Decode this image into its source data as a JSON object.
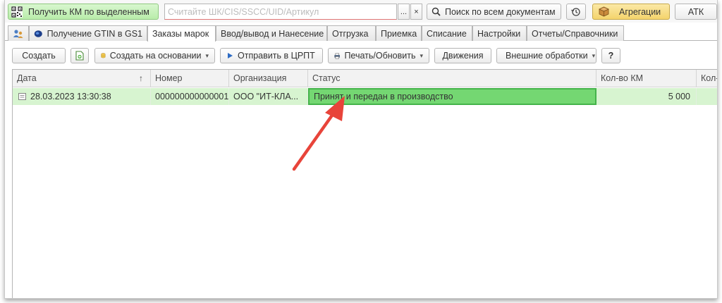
{
  "toolbar": {
    "scan_button": "Получить КМ по выделенным",
    "search_placeholder": "Считайте ШК/CIS/SSCC/UID/Артикул",
    "more_glyph": "...",
    "clear_glyph": "×",
    "search_all": "Поиск по всем документам",
    "aggregations": "Агрегации",
    "atk": "АТК"
  },
  "tabs": [
    {
      "label": ""
    },
    {
      "label": "Получение GTIN в GS1"
    },
    {
      "label": "Заказы марок"
    },
    {
      "label": "Ввод/вывод и Нанесение"
    },
    {
      "label": "Отгрузка"
    },
    {
      "label": "Приемка"
    },
    {
      "label": "Списание"
    },
    {
      "label": "Настройки"
    },
    {
      "label": "Отчеты/Справочники"
    }
  ],
  "commands": {
    "create": "Создать",
    "create_based": "Создать на основании",
    "send": "Отправить в ЦРПТ",
    "print": "Печать/Обновить",
    "movements": "Движения",
    "external": "Внешние обработки",
    "help": "?"
  },
  "grid": {
    "columns": [
      "Дата",
      "Номер",
      "Организация",
      "Статус",
      "Кол-во КМ",
      "Кол-в"
    ],
    "sort_glyph": "↑",
    "rows": [
      {
        "date": "28.03.2023 13:30:38",
        "number": "000000000000001",
        "org": "ООО \"ИТ-КЛА...",
        "status": "Принят и передан в производство",
        "qty": "5 000"
      }
    ]
  },
  "colors": {
    "selected_row": "#d7f4d0",
    "status_highlight": "#74d772",
    "arrow": "#e8443a"
  }
}
